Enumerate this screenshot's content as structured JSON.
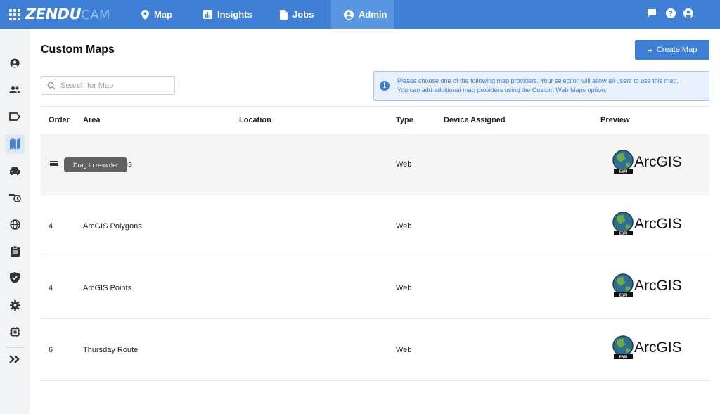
{
  "header": {
    "logo_main": "ZENDU",
    "logo_suffix": "CAM",
    "nav": [
      {
        "label": "Map",
        "icon": "map-pin-icon"
      },
      {
        "label": "Insights",
        "icon": "chart-icon"
      },
      {
        "label": "Jobs",
        "icon": "document-icon"
      },
      {
        "label": "Admin",
        "icon": "user-circle-icon",
        "active": true
      }
    ],
    "right_icons": [
      "chat-icon",
      "help-icon",
      "account-icon"
    ]
  },
  "sidebar": {
    "items": [
      "user-icon",
      "users-icon",
      "tag-icon",
      "map-icon",
      "car-icon",
      "vehicle-history-icon",
      "globe-icon",
      "clipboard-icon",
      "shield-icon",
      "gear-icon",
      "chip-icon",
      "expand-icon"
    ],
    "active": "map-icon"
  },
  "page": {
    "title": "Custom Maps",
    "create_button": "Create Map",
    "search_placeholder": "Search for Map",
    "info_line1": "Please choose one of the following map providers. Your selection will allow all users to use this map.",
    "info_line2": "You can add additional map providers using the Custom Web Maps option."
  },
  "table": {
    "headers": {
      "order": "Order",
      "area": "Area",
      "location": "Location",
      "type": "Type",
      "device": "Device Assigned",
      "preview": "Preview"
    },
    "rows": [
      {
        "order": "",
        "area": "nes",
        "location": "",
        "type": "Web",
        "device": "",
        "preview": "ArcGIS"
      },
      {
        "order": "4",
        "area": "ArcGIS Polygons",
        "location": "",
        "type": "Web",
        "device": "",
        "preview": "ArcGIS"
      },
      {
        "order": "4",
        "area": "ArcGIS Points",
        "location": "",
        "type": "Web",
        "device": "",
        "preview": "ArcGIS"
      },
      {
        "order": "6",
        "area": "Thursday Route",
        "location": "",
        "type": "Web",
        "device": "",
        "preview": "ArcGIS"
      }
    ],
    "tooltip": "Drag to re-order"
  },
  "colors": {
    "primary": "#3f7fd6",
    "info_bg": "#e8f1fb"
  }
}
